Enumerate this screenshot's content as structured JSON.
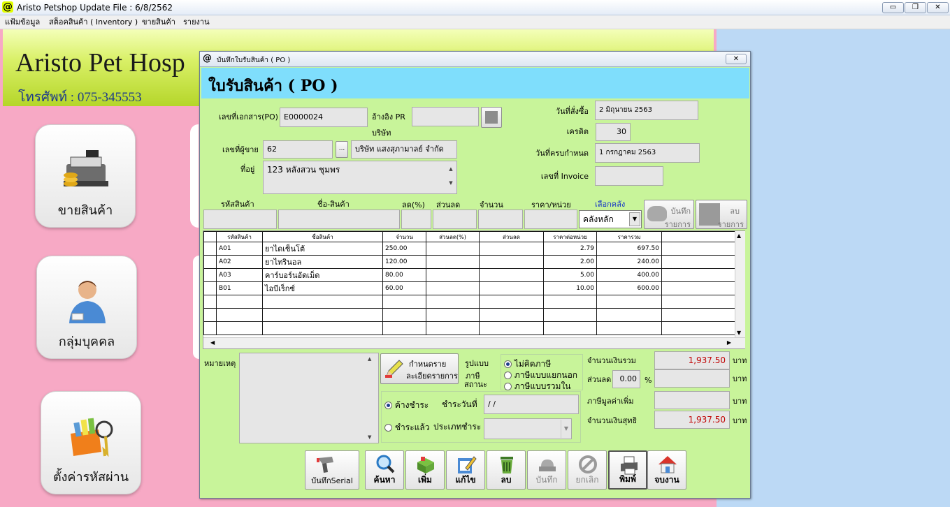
{
  "window": {
    "title": "Aristo Petshop  Update File : 6/8/2562",
    "icon": "@",
    "btn_minimize": "▭",
    "btn_restore": "❐",
    "btn_close": "✕"
  },
  "menu": [
    "แฟ้มข้อมูล",
    "สต็อคสินค้า ( Inventory )",
    "ขายสินค้า",
    "รายงาน"
  ],
  "banner": {
    "name": "Aristo Pet Hosp",
    "phone": "โทรศัพท์ : 075-345553"
  },
  "tiles": [
    {
      "label": "ขายสินค้า",
      "icon": "cash-register-icon"
    },
    {
      "label": "กลุ่มบุคคล",
      "icon": "person-icon"
    },
    {
      "label": "ตั้งค่ารหัสผ่าน",
      "icon": "folder-keys-icon"
    }
  ],
  "dialog": {
    "title_icon": "@",
    "title": "บันทึกใบรับสินค้า ( PO )",
    "close": "✕",
    "heading": "ใบรับสินค้า ( PO )",
    "doc_no_label": "เลขที่เอกสาร(PO)",
    "doc_no": "E0000024",
    "ref_pr_label": "อ้างอิง PR",
    "ref_pr": "",
    "company_label": "บริษัท",
    "vendor_no_label": "เลขที่ผู้ขาย",
    "vendor_no": "62",
    "ellipsis": "...",
    "company": "บริษัท แสงสุภามาลย์ จำกัด",
    "address_label": "ที่อยู่",
    "address": "123 หลังสวน ชุมพร",
    "order_date_label": "วันที่สั่งซื้อ",
    "order_date": "2 มิถุนายน 2563",
    "credit_label": "เครดิต",
    "credit": "30",
    "due_date_label": "วันที่ครบกำหนด",
    "due_date": "1 กรกฎาคม 2563",
    "invoice_label": "เลขที่ Invoice",
    "invoice": "",
    "entry": {
      "code_label": "รหัสสินค้า",
      "name_label": "ชื่อ-สินค้า",
      "disc_pct_label": "ลด(%)",
      "discount_label": "ส่วนลด",
      "qty_label": "จำนวน",
      "price_label": "ราคา/หน่วย",
      "warehouse_label": "เลือกคลัง",
      "warehouse": "คลังหลัก",
      "save_item_label": "บันทึก",
      "save_item_label2": "รายการ",
      "delete_item_label": "ลบ",
      "delete_item_label2": "รายการ"
    },
    "grid": {
      "columns": [
        "รหัสสินค้า",
        "ชื่อสินค้า",
        "จำนวน",
        "ส่วนลด(%)",
        "ส่วนลด",
        "ราคาต่อหน่วย",
        "ราคารวม"
      ],
      "rows": [
        {
          "code": "A01",
          "name": "ยาไดเซ็นโต้",
          "qty": "250.00",
          "disc_pct": "",
          "disc": "",
          "price": "2.79",
          "total": "697.50"
        },
        {
          "code": "A02",
          "name": "ยาไทรินอล",
          "qty": "120.00",
          "disc_pct": "",
          "disc": "",
          "price": "2.00",
          "total": "240.00"
        },
        {
          "code": "A03",
          "name": "คาร์บอร์นอัดเม็ด",
          "qty": "80.00",
          "disc_pct": "",
          "disc": "",
          "price": "5.00",
          "total": "400.00"
        },
        {
          "code": "B01",
          "name": "ไอบีเร็กซ์",
          "qty": "60.00",
          "disc_pct": "",
          "disc": "",
          "price": "10.00",
          "total": "600.00"
        }
      ]
    },
    "note_label": "หมายเหตุ :",
    "detail_btn_line1": "กำหนดราย",
    "detail_btn_line2": "ละเอียดรายการ",
    "tax_mode_label1": "รูปแบบ",
    "tax_mode_label2": "ภาษี",
    "tax_status_label": "สถานะ",
    "tax_options": [
      "ไม่คิดภาษี",
      "ภาษีแบบแยกนอก",
      "ภาษีแบบรวมใน"
    ],
    "pay_options": [
      "ค้างชำระ",
      "ชำระแล้ว"
    ],
    "pay_date_label": "ชำระวันที่",
    "pay_date": " / /",
    "pay_type_label": "ประเภทชำระ",
    "summary": {
      "total_label": "จำนวนเงินรวม",
      "total": "1,937.50",
      "discount_label": "ส่วนลด",
      "discount_pct": "0.00",
      "pct": "%",
      "vat_label": "ภาษีมูลค่าเพิ่ม",
      "net_label": "จำนวนเงินสุทธิ",
      "net": "1,937.50",
      "baht": "บาท"
    },
    "toolbar": {
      "serial": "บันทึกSerial",
      "search": "ค้นหา",
      "add": "เพิ่ม",
      "edit": "แก้ไข",
      "delete": "ลบ",
      "save": "บันทึก",
      "cancel": "ยกเลิก",
      "print": "พิมพ์",
      "close": "จบงาน"
    }
  }
}
